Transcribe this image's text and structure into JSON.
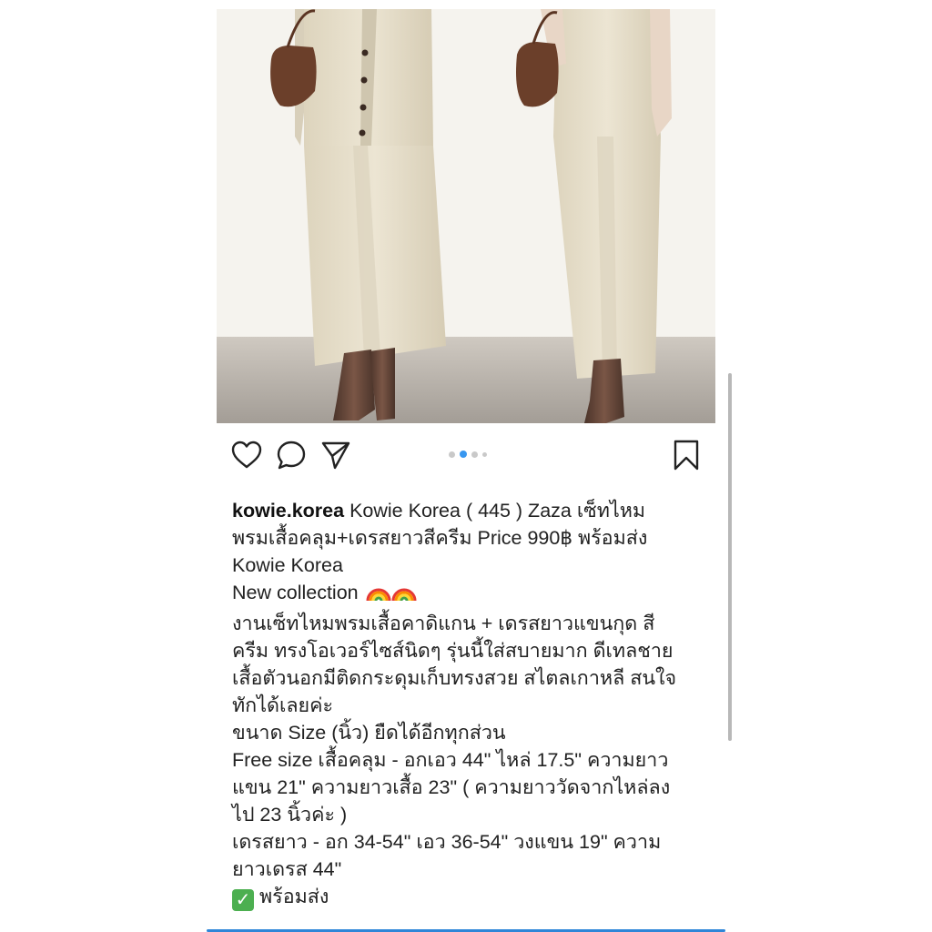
{
  "post": {
    "image_alt": "two models in cream knit cardigan and long dress",
    "carousel": {
      "count": 4,
      "active": 2
    },
    "actions": {
      "like_icon": "heart-icon",
      "comment_icon": "comment-icon",
      "share_icon": "send-icon",
      "save_icon": "bookmark-icon"
    },
    "caption": {
      "username": "kowie.korea",
      "line1_rest": " Kowie Korea  ( 445 ) Zaza เซ็ทไหม",
      "line2": "พรมเสื้อคลุม+เดรสยาวสีครีม Price  990฿ พร้อมส่ง",
      "line3": "Kowie Korea",
      "line4": "New collection ",
      "line5": "  งานเซ็ทไหมพรมเสื้อคาดิแกน + เดรสยาวแขนกุด สี",
      "line6": "ครีม ทรงโอเวอร์ไซส์นิดๆ รุ่นนี้ใส่สบายมาก ดีเทลชาย",
      "line7": "เสื้อตัวนอกมีติดกระดุมเก็บทรงสวย สไตลเกาหลี สนใจ",
      "line8": "ทักได้เลยค่ะ",
      "line9": "ขนาด Size (นิ้ว) ยืดได้อีกทุกส่วน",
      "line10": "Free size เสื้อคลุม - อกเอว 44\" ไหล่ 17.5\" ความยาว",
      "line11": "แขน 21\" ความยาวเสื้อ 23\" ( ความยาววัดจากไหล่ลง",
      "line12": "ไป 23 นิ้วค่ะ )",
      "line13": "เดรสยาว - อก 34-54\" เอว 36-54\" วงแขน 19\" ความ",
      "line14": "ยาวเดรส 44\"",
      "line15": "พร้อมส่ง"
    }
  },
  "colors": {
    "accent": "#3897f0",
    "text": "#222222",
    "knit": "#e9e2cf",
    "boot": "#5a4034",
    "bag": "#6b3f2a"
  }
}
